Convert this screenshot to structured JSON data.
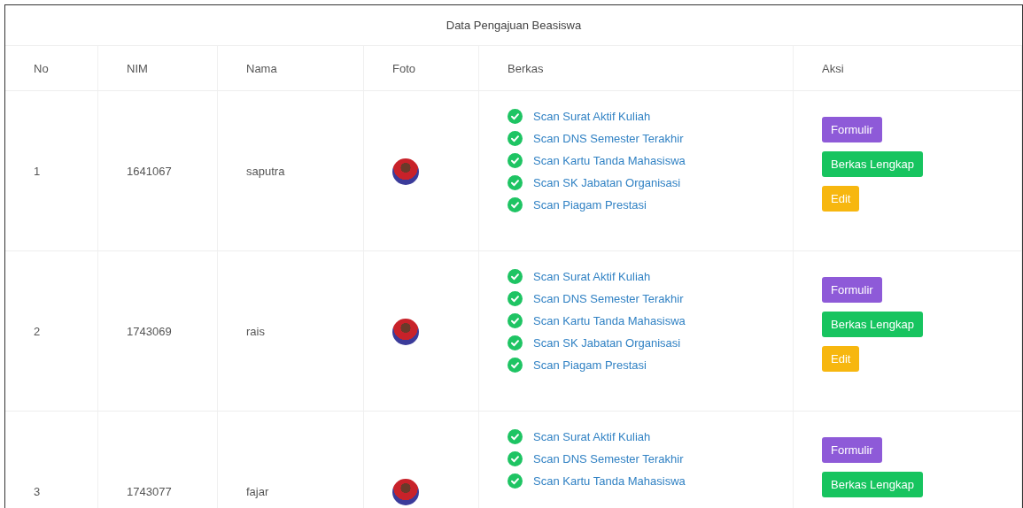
{
  "title": "Data Pengajuan Beasiswa",
  "columns": [
    "No",
    "NIM",
    "Nama",
    "Foto",
    "Berkas",
    "Aksi"
  ],
  "rows": [
    {
      "no": "1",
      "nim": "1641067",
      "nama": "saputra",
      "berkas": [
        {
          "label": "Scan Surat Aktif Kuliah",
          "checked": true
        },
        {
          "label": "Scan DNS Semester Terakhir",
          "checked": true
        },
        {
          "label": "Scan Kartu Tanda Mahasiswa",
          "checked": true
        },
        {
          "label": "Scan SK Jabatan Organisasi",
          "checked": true
        },
        {
          "label": "Scan Piagam Prestasi",
          "checked": true
        }
      ],
      "actions": [
        {
          "kind": "form",
          "label": "Formulir"
        },
        {
          "kind": "files",
          "label": "Berkas Lengkap"
        },
        {
          "kind": "edit",
          "label": "Edit"
        }
      ]
    },
    {
      "no": "2",
      "nim": "1743069",
      "nama": "rais",
      "berkas": [
        {
          "label": "Scan Surat Aktif Kuliah",
          "checked": true
        },
        {
          "label": "Scan DNS Semester Terakhir",
          "checked": true
        },
        {
          "label": "Scan Kartu Tanda Mahasiswa",
          "checked": true
        },
        {
          "label": "Scan SK Jabatan Organisasi",
          "checked": true
        },
        {
          "label": "Scan Piagam Prestasi",
          "checked": true
        }
      ],
      "actions": [
        {
          "kind": "form",
          "label": "Formulir"
        },
        {
          "kind": "files",
          "label": "Berkas Lengkap"
        },
        {
          "kind": "edit",
          "label": "Edit"
        }
      ]
    },
    {
      "no": "3",
      "nim": "1743077",
      "nama": "fajar",
      "berkas": [
        {
          "label": "Scan Surat Aktif Kuliah",
          "checked": true
        },
        {
          "label": "Scan DNS Semester Terakhir",
          "checked": true
        },
        {
          "label": "Scan Kartu Tanda Mahasiswa",
          "checked": true
        }
      ],
      "actions": [
        {
          "kind": "form",
          "label": "Formulir"
        },
        {
          "kind": "files",
          "label": "Berkas Lengkap"
        }
      ]
    }
  ]
}
